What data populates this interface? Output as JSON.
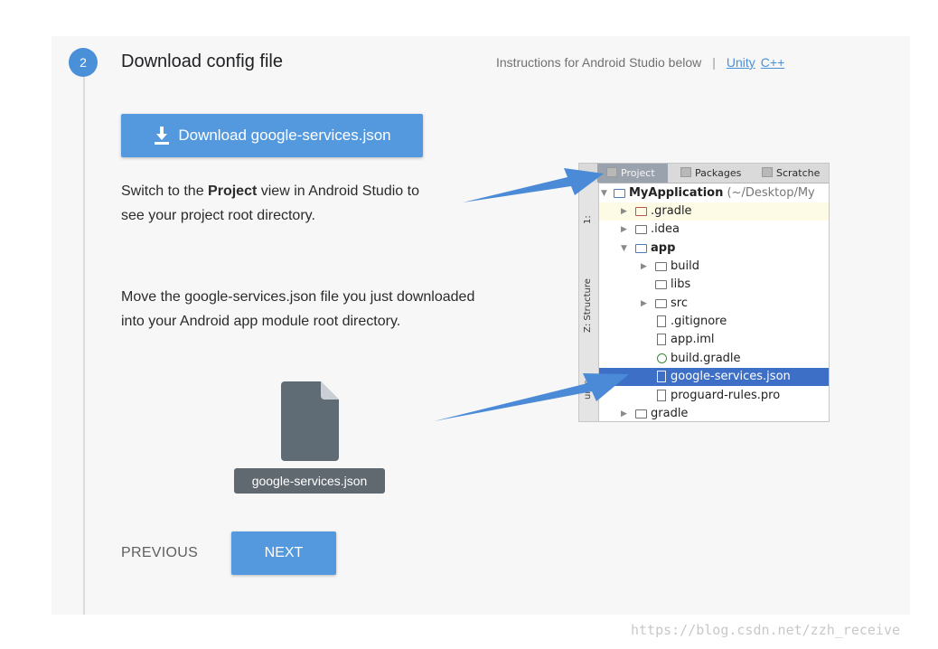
{
  "step": {
    "number": "2",
    "title": "Download config file"
  },
  "instructions": {
    "text": "Instructions for Android Studio below",
    "separator": "|",
    "links": [
      "Unity",
      "C++"
    ]
  },
  "download_button": {
    "label": "Download google-services.json"
  },
  "paragraph1": {
    "before": "Switch to the ",
    "bold": "Project",
    "after": " view in Android Studio to see your project root directory."
  },
  "paragraph2": {
    "text": "Move the google-services.json file you just downloaded into your Android app module root directory."
  },
  "file": {
    "label": "google-services.json"
  },
  "nav": {
    "previous": "PREVIOUS",
    "next": "NEXT"
  },
  "android_studio": {
    "tabs": [
      "Project",
      "Packages",
      "Scratche"
    ],
    "sidebar": [
      "1:",
      "Z: Structure",
      "ures"
    ],
    "tree": [
      {
        "label": "MyApplication",
        "suffix": "(~/Desktop/My",
        "type": "root"
      },
      {
        "label": ".gradle",
        "type": "folder"
      },
      {
        "label": ".idea",
        "type": "folder"
      },
      {
        "label": "app",
        "type": "module"
      },
      {
        "label": "build",
        "type": "folder"
      },
      {
        "label": "libs",
        "type": "folder"
      },
      {
        "label": "src",
        "type": "folder"
      },
      {
        "label": ".gitignore",
        "type": "file"
      },
      {
        "label": "app.iml",
        "type": "file"
      },
      {
        "label": "build.gradle",
        "type": "gradle"
      },
      {
        "label": "google-services.json",
        "type": "file",
        "selected": true
      },
      {
        "label": "proguard-rules.pro",
        "type": "file"
      },
      {
        "label": "gradle",
        "type": "folder"
      }
    ]
  },
  "colors": {
    "accent": "#5499dd",
    "selection": "#3d6fc6",
    "file_label_bg": "#606870"
  },
  "watermark": "https://blog.csdn.net/zzh_receive"
}
